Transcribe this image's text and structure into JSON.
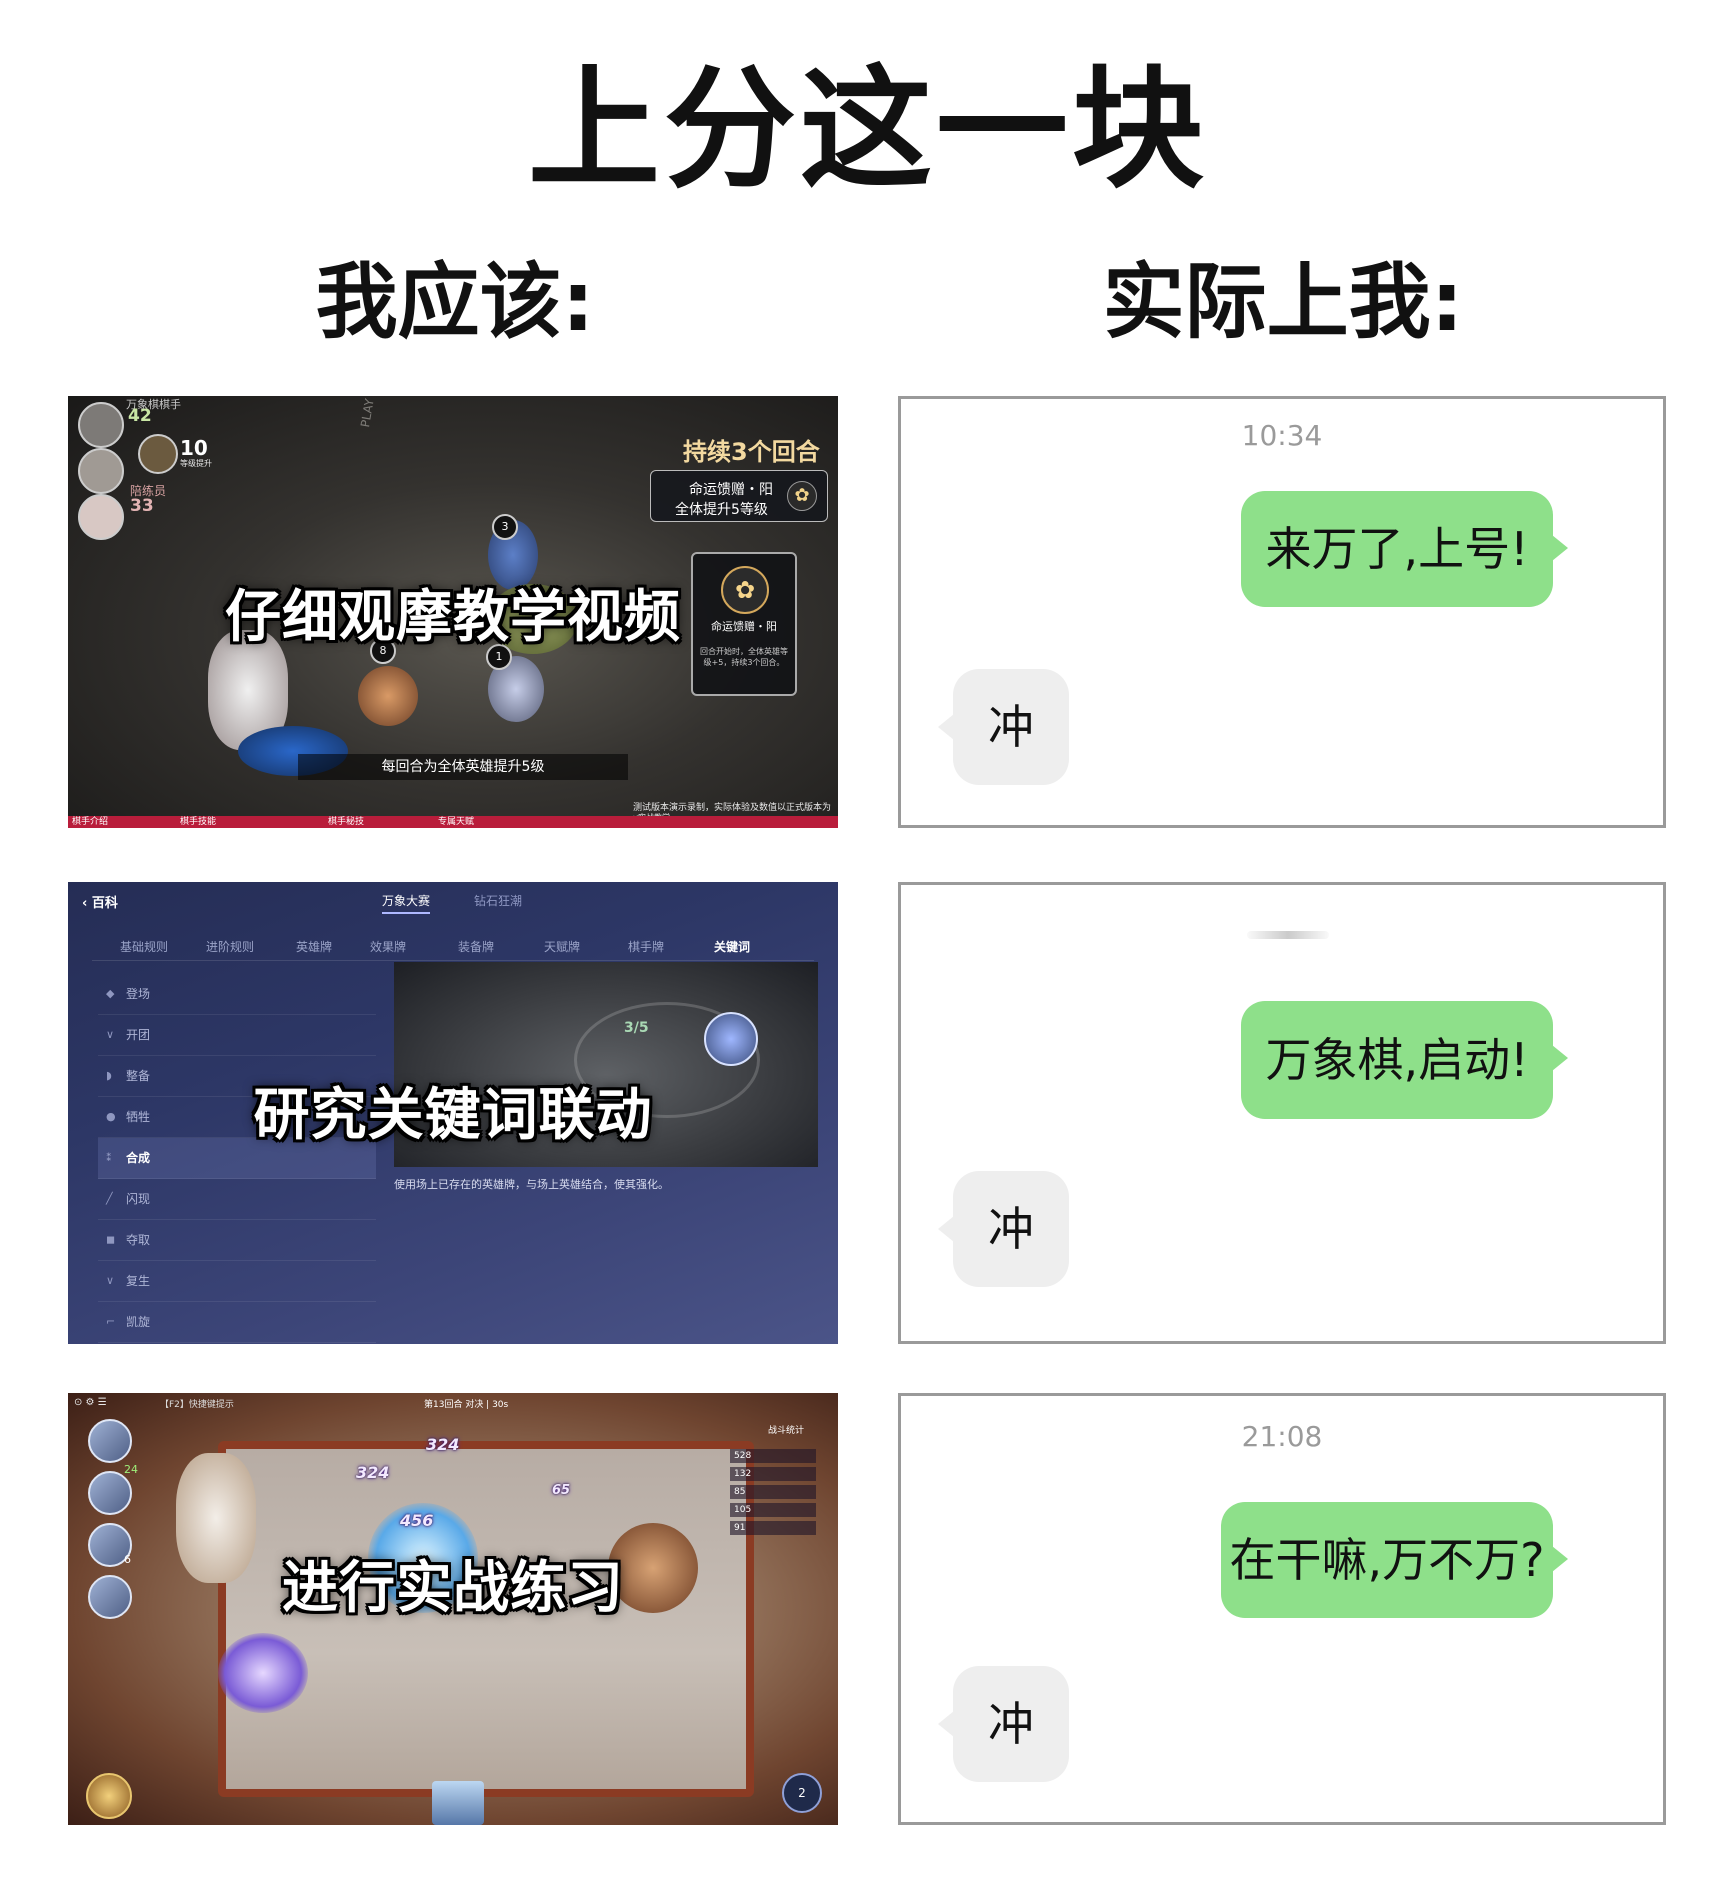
{
  "title": "上分这一块",
  "left_heading": "我应该:",
  "right_heading": "实际上我:",
  "panels": [
    {
      "caption": "仔细观摩教学视频",
      "top_left_label": "万象棋棋手",
      "stat_42": "42",
      "stat_10": "10",
      "stat_10_sub": "等级提升",
      "stat_33_label": "陪练员",
      "stat_33": "33",
      "duration_title": "持续3个回合",
      "card_line1": "命运馈赠・阳",
      "card_line2": "全体提升5等级",
      "side_card_name": "命运馈赠・阳",
      "side_card_desc": "回合开始时，全体英雄等级+5，持续3个回合。",
      "tip": "每回合为全体英雄提升5级",
      "wall_text": "PLAY TOGETHER",
      "bottom_tabs": [
        "棋手介绍",
        "棋手技能",
        "棋手秘技",
        "专属天赋"
      ],
      "disclaimer": "测试版本演示录制，实际体验及数值以正式版本为准",
      "disclaimer_sub": "实战教学",
      "badges": [
        "3",
        "8",
        "1"
      ]
    },
    {
      "caption": "研究关键词联动",
      "back": "百科",
      "top_tabs": [
        "万象大赛",
        "钻石狂潮"
      ],
      "sub_tabs": [
        "基础规则",
        "进阶规则",
        "英雄牌",
        "效果牌",
        "装备牌",
        "天赋牌",
        "棋手牌",
        "关键词"
      ],
      "side_items": [
        "登场",
        "开团",
        "整备",
        "牺牲",
        "合成",
        "闪现",
        "夺取",
        "复生",
        "凯旋"
      ],
      "selected_item": "合成",
      "description": "使用场上已存在的英雄牌，与场上英雄结合，使其强化。",
      "screen_counter": "3/5"
    },
    {
      "caption": "进行实战练习",
      "top_bar": "【F2】快捷键提示",
      "round_info": "第13回合 对决 | 30s",
      "battle_stats": "战斗统计",
      "damage": [
        "324",
        "324",
        "456",
        "65"
      ],
      "avatar_nums": [
        "24",
        "6"
      ],
      "right_list": [
        "528",
        "132",
        "85",
        "105",
        "91"
      ],
      "bottom_level": "2"
    }
  ],
  "chats": [
    {
      "time": "10:34",
      "me": "来万了,上号!",
      "reply": "冲"
    },
    {
      "time": "",
      "me": "万象棋,启动!",
      "reply": "冲"
    },
    {
      "time": "21:08",
      "me": "在干嘛,万不万?",
      "reply": "冲"
    }
  ],
  "colors": {
    "bubble_me": "#8ee08a",
    "bubble_other": "#eeeeee",
    "time": "#9a9a9a",
    "border": "#9a9a9a"
  }
}
